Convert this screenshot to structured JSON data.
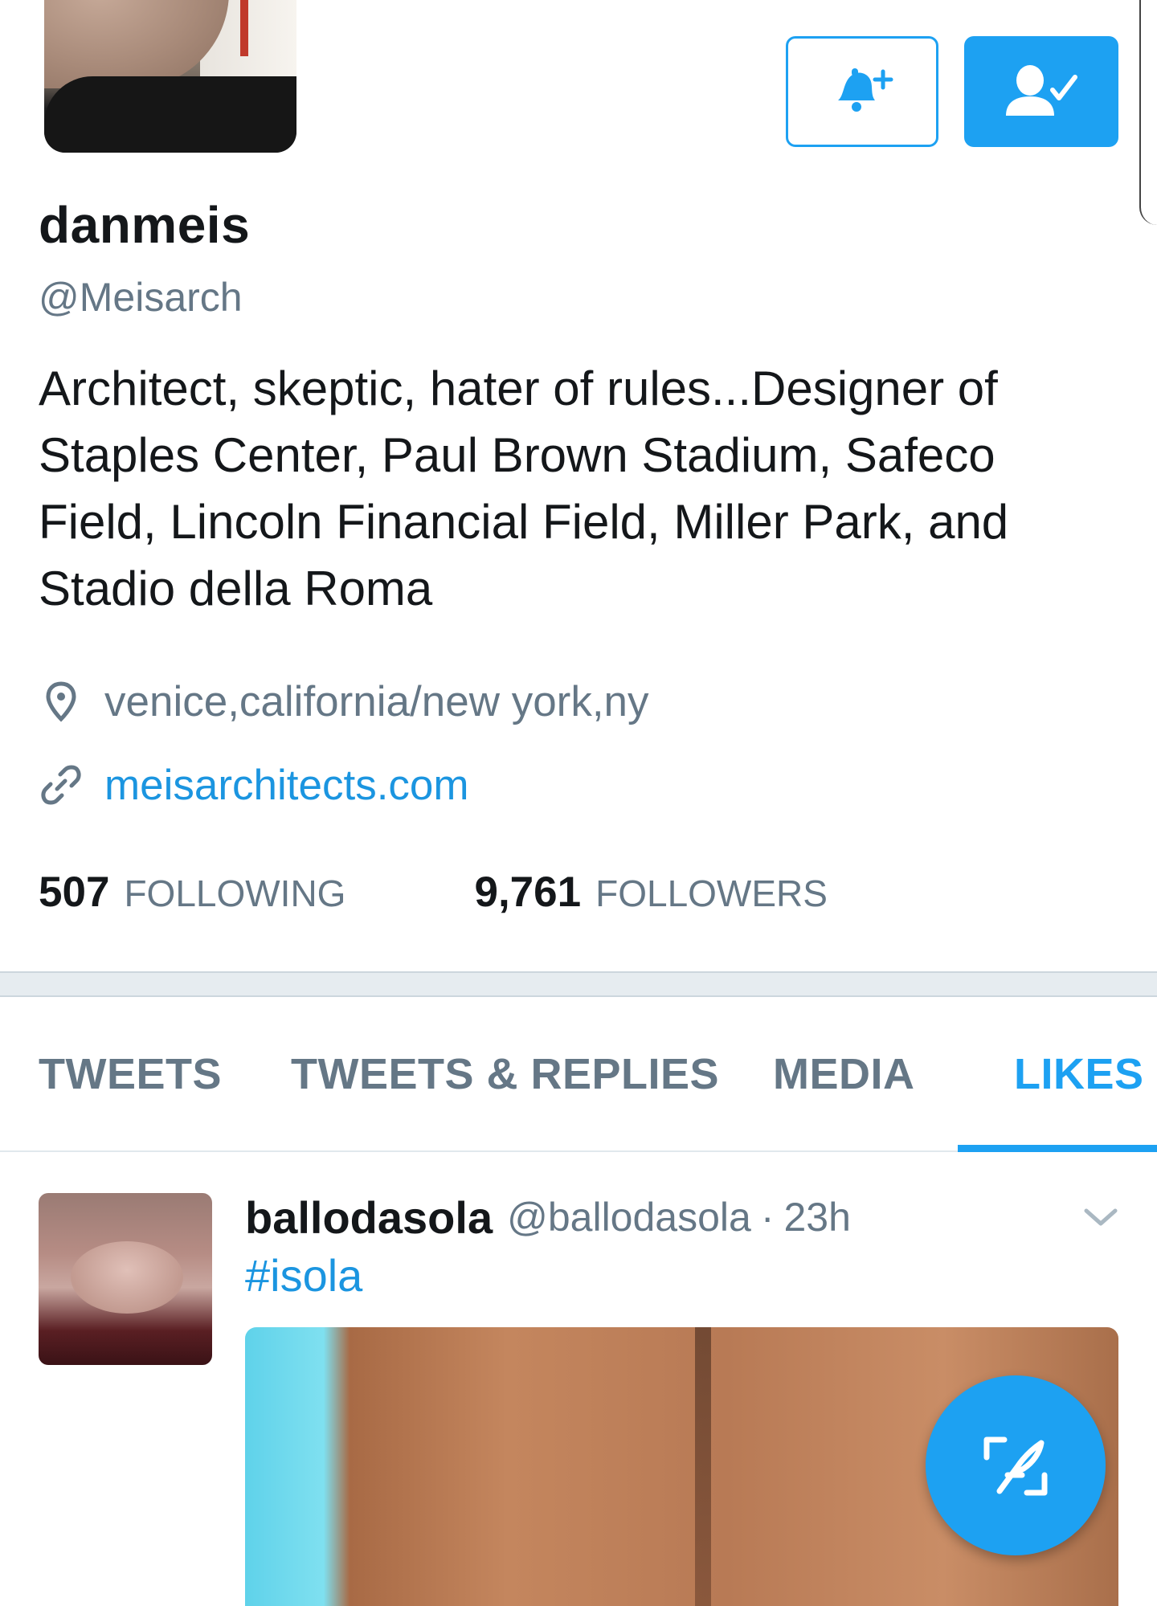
{
  "profile": {
    "display_name": "danmeis",
    "handle": "@Meisarch",
    "bio": "Architect, skeptic, hater of rules...Designer of Staples Center, Paul Brown Stadium, Safeco Field, Lincoln Financial Field, Miller Park, and Stadio della Roma",
    "location": "venice,california/new york,ny",
    "website": "meisarchitects.com",
    "following_count": "507",
    "following_label": "FOLLOWING",
    "followers_count": "9,761",
    "followers_label": "FOLLOWERS",
    "avatar_icon": "profile-photo"
  },
  "actions": {
    "notify_icon": "bell-plus-icon",
    "following_icon": "user-check-icon"
  },
  "tabs": [
    {
      "label": "TWEETS",
      "active": false
    },
    {
      "label": "TWEETS & REPLIES",
      "active": false
    },
    {
      "label": "MEDIA",
      "active": false
    },
    {
      "label": "LIKES",
      "active": true
    }
  ],
  "tweet": {
    "author": "ballodasola",
    "handle": "@ballodasola",
    "separator": "·",
    "time": "23h",
    "text": "#isola",
    "caret_icon": "chevron-down-icon"
  },
  "fab": {
    "icon": "compose-feather-icon"
  },
  "colors": {
    "accent": "#1da1f2",
    "link": "#1b95e0",
    "secondary_text": "#657786",
    "primary_text": "#14171a",
    "divider": "#e6ecf0"
  }
}
